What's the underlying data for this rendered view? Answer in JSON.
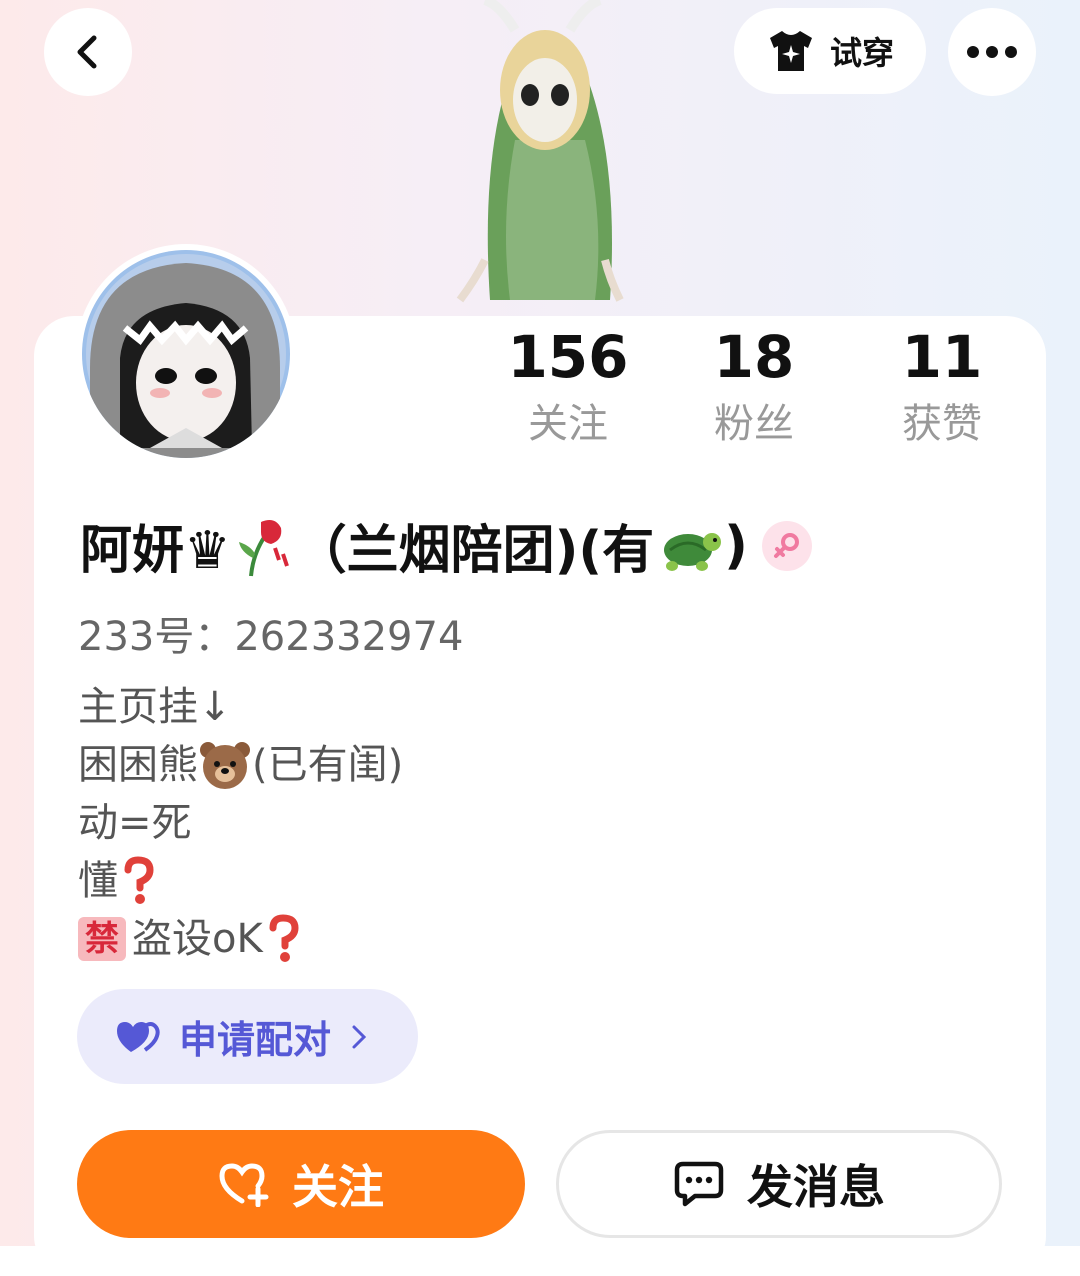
{
  "header": {
    "try_on_label": "试穿",
    "icons": [
      "back-arrow-icon",
      "tshirt-sparkle-icon",
      "more-dots-icon"
    ]
  },
  "stats": [
    {
      "value": "156",
      "label": "关注"
    },
    {
      "value": "18",
      "label": "粉丝"
    },
    {
      "value": "11",
      "label": "获赞"
    }
  ],
  "profile": {
    "name_prefix": "阿妍♛",
    "name_mid": "（兰烟陪团)(有",
    "name_suffix": ")",
    "gender": "female",
    "uid_text": "233号：262332974"
  },
  "bio": {
    "line1": "主页挂↓",
    "line2_a": "困困熊",
    "line2_b": "(已有闺)",
    "line3": "动=死",
    "line4": "懂",
    "line5_badge": "禁",
    "line5": "盗设oK"
  },
  "pair_button": {
    "label": "申请配对"
  },
  "actions": {
    "follow_label": "关注",
    "message_label": "发消息"
  },
  "colors": {
    "accent_orange": "#ff7a14",
    "pair_purple": "#5558d6",
    "pair_bg": "#ebebfb"
  }
}
